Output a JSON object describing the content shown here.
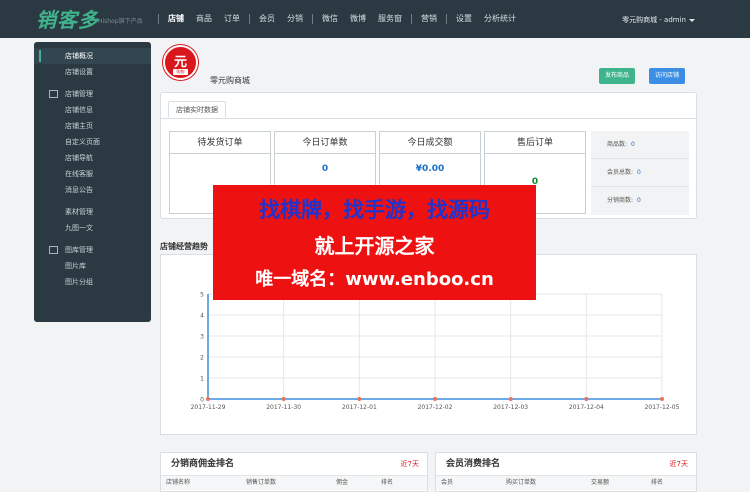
{
  "brand": {
    "logo_text": "销客多",
    "sub": "Hishop旗下产品"
  },
  "nav": [
    "店铺",
    "商品",
    "订单",
    "会员",
    "分销",
    "微信",
    "微博",
    "服务窗",
    "营销",
    "设置",
    "分析统计"
  ],
  "user": "零元购商城 - admin",
  "sidebar": {
    "group1": [
      "店铺概况",
      "店铺设置"
    ],
    "group2_title": "店铺管理",
    "group2": [
      "店铺信息",
      "店铺主页",
      "自定义页面",
      "店铺导航",
      "在线客服",
      "消息公告"
    ],
    "group3": [
      "素材管理",
      "九图一文"
    ],
    "group4_title": "图库管理",
    "group4": [
      "图片库",
      "图片分组"
    ]
  },
  "store": {
    "logo_glyph": "元",
    "logo_tag": "购物",
    "name": "零元购商城"
  },
  "buttons": {
    "publish": "发布商品",
    "visit": "访问店铺"
  },
  "realtime": {
    "tab": "店铺实时数据",
    "cards": [
      {
        "label": "待发货订单",
        "value": "0"
      },
      {
        "label": "今日订单数",
        "value": "0"
      },
      {
        "label": "今日成交额",
        "value": "¥0.00"
      },
      {
        "label": "售后订单",
        "value": "0"
      }
    ],
    "counts": [
      {
        "label": "商品数:",
        "value": "0"
      },
      {
        "label": "会员总数:",
        "value": "0"
      },
      {
        "label": "分销商数:",
        "value": "0"
      }
    ]
  },
  "trend_title": "店铺经营趋势",
  "chart_data": {
    "type": "line",
    "title": "店铺经营趋势",
    "x": [
      "2017-11-29",
      "2017-11-30",
      "2017-12-01",
      "2017-12-02",
      "2017-12-03",
      "2017-12-04",
      "2017-12-05"
    ],
    "series": [
      {
        "values": [
          0,
          0,
          0,
          0,
          0,
          0,
          0
        ]
      }
    ],
    "y_ticks": [
      "0",
      "1",
      "2",
      "3",
      "4",
      "5"
    ],
    "ylim": [
      0,
      5
    ],
    "grid": true,
    "line_color": "#3b8ee3",
    "point_color": "#e8735a"
  },
  "rank_left": {
    "title": "分销商佣金排名",
    "days": "近7天",
    "cols": [
      "店铺名称",
      "销售订单数",
      "佣金",
      "排名"
    ]
  },
  "rank_right": {
    "title": "会员消费排名",
    "days": "近7天",
    "cols": [
      "会员",
      "购买订单数",
      "交易额",
      "排名"
    ]
  },
  "banner": {
    "line1": "找棋牌，找手游，找源码",
    "line2": "就上开源之家",
    "line3": "唯一域名：www.enboo.cn"
  }
}
